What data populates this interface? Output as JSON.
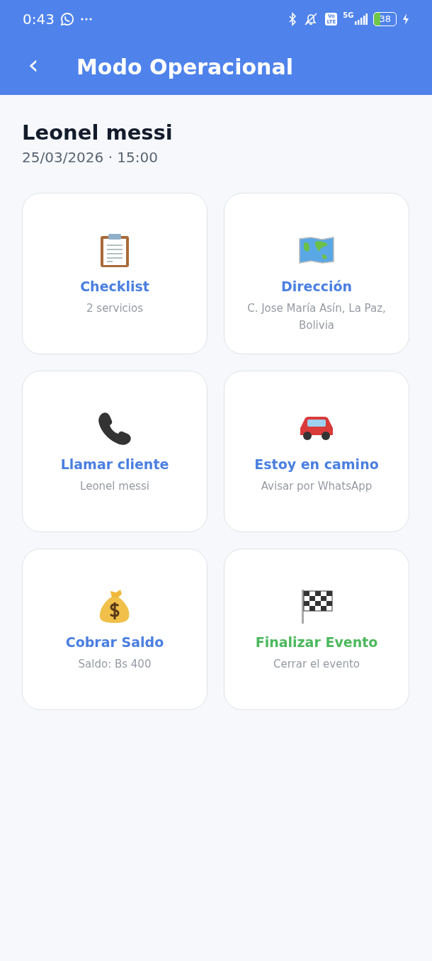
{
  "status_bar": {
    "time": "0:43",
    "volte": [
      "Vo",
      "LTE"
    ],
    "network": "5G",
    "battery": "38"
  },
  "header": {
    "back": "‹",
    "title": "Modo Operacional"
  },
  "client": {
    "name": "Leonel messi",
    "date": "25/03/2026 · 15:00"
  },
  "actions": [
    {
      "kind": "clipboard",
      "title": "Checklist",
      "subtitle": "2 servicios",
      "color": "#4a7fe0"
    },
    {
      "kind": "map",
      "title": "Dirección",
      "subtitle": "C. Jose María Asín, La Paz, Bolivia",
      "color": "#4a7fe0"
    },
    {
      "kind": "phone",
      "title": "Llamar cliente",
      "subtitle": "Leonel messi",
      "color": "#4a7fe0"
    },
    {
      "kind": "car",
      "title": "Estoy en camino",
      "subtitle": "Avisar por WhatsApp",
      "color": "#4a7fe0"
    },
    {
      "kind": "money",
      "title": "Cobrar Saldo",
      "subtitle": "Saldo: Bs 400",
      "color": "#4a7fe0"
    },
    {
      "kind": "flag",
      "title": "Finalizar Evento",
      "subtitle": "Cerrar el evento",
      "color": "#4cb85c"
    }
  ]
}
